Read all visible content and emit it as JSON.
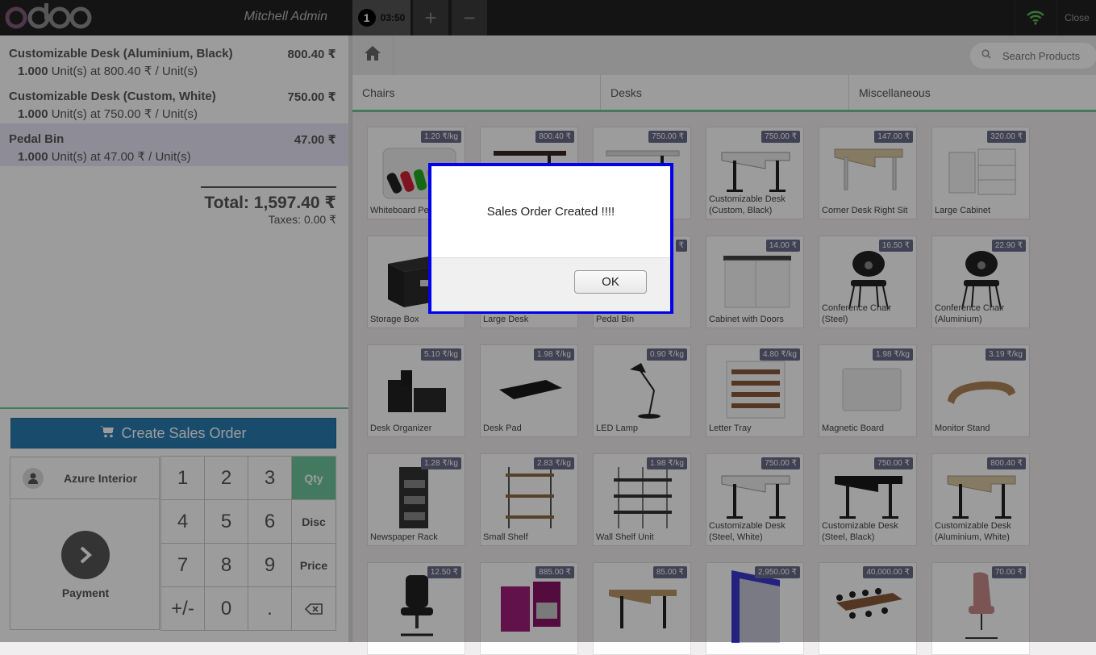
{
  "topbar": {
    "logo_text": "odoo",
    "username": "Mitchell Admin",
    "order_number": "1",
    "order_time": "03:50",
    "add_label": "+",
    "remove_label": "−",
    "close_label": "Close",
    "wifi_icon": "wifi-icon"
  },
  "order": {
    "lines": [
      {
        "name": "Customizable Desk (Aluminium, Black)",
        "price": "800.40 ₹",
        "qty": "1.000",
        "info": " Unit(s) at 800.40 ₹ / Unit(s)"
      },
      {
        "name": "Customizable Desk (Custom, White)",
        "price": "750.00 ₹",
        "qty": "1.000",
        "info": " Unit(s) at 750.00 ₹ / Unit(s)"
      },
      {
        "name": "Pedal Bin",
        "price": "47.00 ₹",
        "qty": "1.000",
        "info": " Unit(s) at 47.00 ₹ / Unit(s)"
      }
    ],
    "total": "Total: 1,597.40 ₹",
    "taxes": "Taxes: 0.00 ₹"
  },
  "actions": {
    "create_sales_order": "Create Sales Order",
    "customer": "Azure Interior",
    "payment": "Payment"
  },
  "numpad": {
    "keys": [
      "1",
      "2",
      "3",
      "Qty",
      "4",
      "5",
      "6",
      "Disc",
      "7",
      "8",
      "9",
      "Price",
      "+/-",
      "0",
      "."
    ],
    "active_mode": "Qty"
  },
  "products_header": {
    "search_placeholder": "Search Products",
    "categories": [
      "Chairs",
      "Desks",
      "Miscellaneous"
    ]
  },
  "products": [
    {
      "name": "Whiteboard Pen",
      "price": "1.20 ₹/kg"
    },
    {
      "name": "",
      "price": "800.40 ₹"
    },
    {
      "name": "",
      "price": "750.00 ₹"
    },
    {
      "name": "Customizable Desk (Custom, Black)",
      "price": "750.00 ₹"
    },
    {
      "name": "Corner Desk Right Sit",
      "price": "147.00 ₹"
    },
    {
      "name": "Large Cabinet",
      "price": "320.00 ₹"
    },
    {
      "name": "Storage Box",
      "price": ""
    },
    {
      "name": "Large Desk",
      "price": ""
    },
    {
      "name": "Pedal Bin",
      "price": "₹"
    },
    {
      "name": "Cabinet with Doors",
      "price": "14.00 ₹"
    },
    {
      "name": "Conference Chair (Steel)",
      "price": "16.50 ₹"
    },
    {
      "name": "Conference Chair (Aluminium)",
      "price": "22.90 ₹"
    },
    {
      "name": "Desk Organizer",
      "price": "5.10 ₹/kg"
    },
    {
      "name": "Desk Pad",
      "price": "1.98 ₹/kg"
    },
    {
      "name": "LED Lamp",
      "price": "0.90 ₹/kg"
    },
    {
      "name": "Letter Tray",
      "price": "4.80 ₹/kg"
    },
    {
      "name": "Magnetic Board",
      "price": "1.98 ₹/kg"
    },
    {
      "name": "Monitor Stand",
      "price": "3.19 ₹/kg"
    },
    {
      "name": "Newspaper Rack",
      "price": "1.28 ₹/kg"
    },
    {
      "name": "Small Shelf",
      "price": "2.83 ₹/kg"
    },
    {
      "name": "Wall Shelf Unit",
      "price": "1.98 ₹/kg"
    },
    {
      "name": "Customizable Desk (Steel, White)",
      "price": "750.00 ₹"
    },
    {
      "name": "Customizable Desk (Steel, Black)",
      "price": "750.00 ₹"
    },
    {
      "name": "Customizable Desk (Aluminium, White)",
      "price": "800.40 ₹"
    },
    {
      "name": "",
      "price": "12.50 ₹"
    },
    {
      "name": "",
      "price": "885.00 ₹"
    },
    {
      "name": "",
      "price": "85.00 ₹"
    },
    {
      "name": "",
      "price": "2,950.00 ₹"
    },
    {
      "name": "",
      "price": "40,000.00 ₹"
    },
    {
      "name": "",
      "price": "70.00 ₹"
    }
  ],
  "dialog": {
    "message": "Sales Order Created !!!!",
    "ok_label": "OK"
  },
  "colors": {
    "accent": "#6ec89b",
    "primary_button": "#2a7db1",
    "dialog_outline": "#0000ee"
  }
}
